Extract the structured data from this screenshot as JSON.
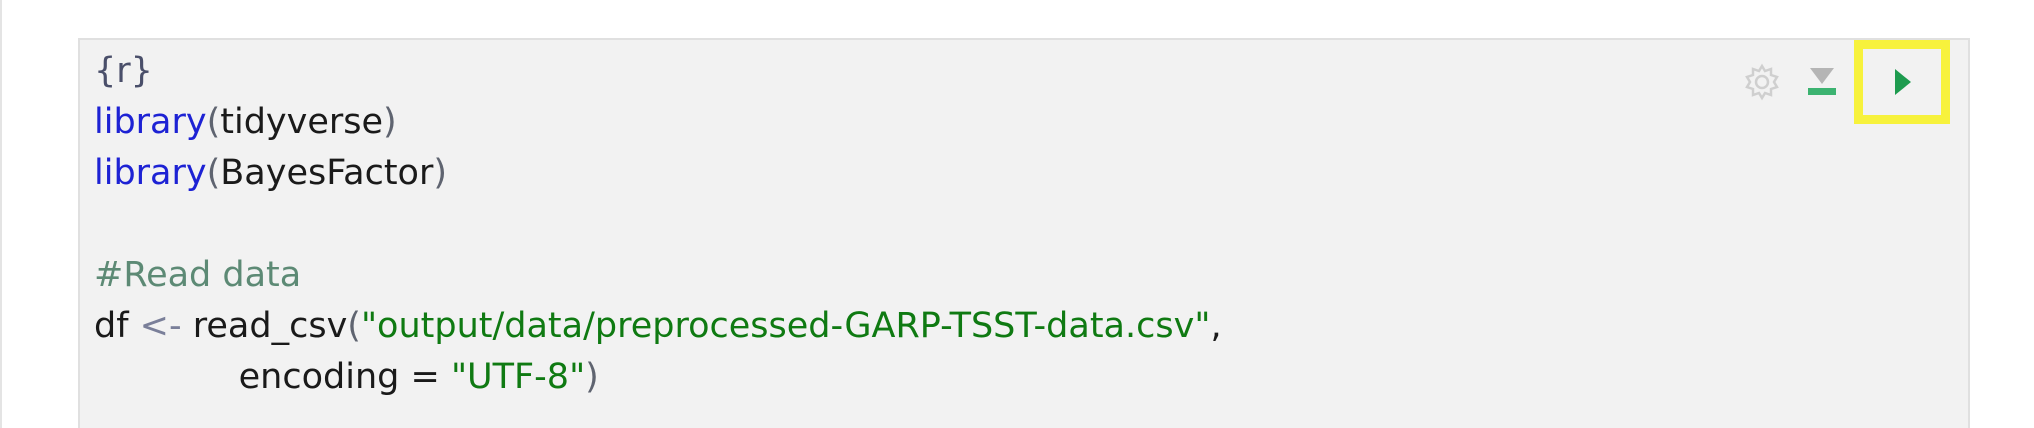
{
  "chunk": {
    "header": "{r}",
    "lines": [
      {
        "fn": "library",
        "open": "(",
        "arg": "tidyverse",
        "close": ")"
      },
      {
        "fn": "library",
        "open": "(",
        "arg": "BayesFactor",
        "close": ")"
      }
    ],
    "comment": "#Read data",
    "assign": {
      "var": "df ",
      "op": "<-",
      "fn": " read_csv",
      "open": "(",
      "path": "\"output/data/preprocessed-GARP-TSST-data.csv\"",
      "comma": ",",
      "indent": "             ",
      "param": "encoding = ",
      "encoding": "\"UTF-8\"",
      "close": ")"
    }
  },
  "toolbar": {
    "settings_icon": "gear-icon",
    "run_above_icon": "run-above-icon",
    "run_icon": "play-icon"
  },
  "colors": {
    "keyword": "#1d22d4",
    "string": "#0f7a12",
    "comment": "#5d8a75",
    "run_accent": "#1e9b4f",
    "highlight": "#f7f23c"
  }
}
